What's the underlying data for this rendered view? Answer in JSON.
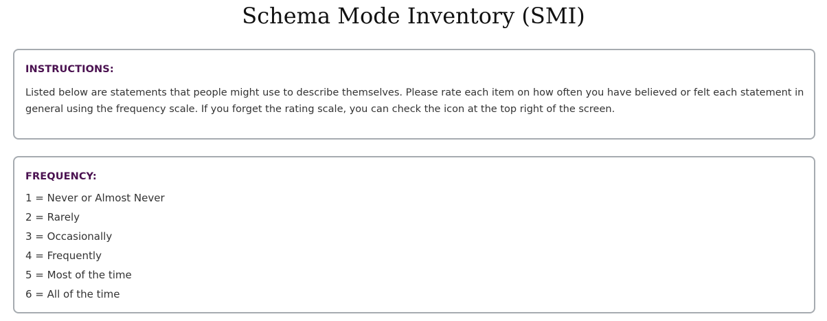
{
  "page": {
    "title": "Schema Mode Inventory (SMI)"
  },
  "instructions": {
    "heading": "INSTRUCTIONS:",
    "body": "Listed below are statements that people might use to describe themselves. Please rate each item on how often you have believed or felt each statement in general using the frequency scale. If you forget the rating scale, you can check the icon at the top right of the screen."
  },
  "frequency": {
    "heading": "FREQUENCY:",
    "items": [
      "1 = Never or Almost Never",
      "2 = Rarely",
      "3 = Occasionally",
      "4 = Frequently",
      "5 = Most of the time",
      "6 = All of the time"
    ]
  },
  "colors": {
    "heading_accent": "#4a1150",
    "card_border": "#a6abb0",
    "body_text": "#333333"
  }
}
